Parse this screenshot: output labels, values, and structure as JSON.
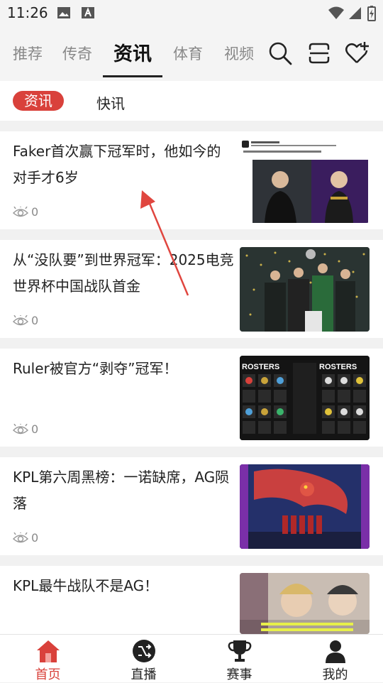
{
  "status_bar": {
    "time": "11:26"
  },
  "top_tabs": [
    {
      "label": "推荐"
    },
    {
      "label": "传奇"
    },
    {
      "label": "资讯"
    },
    {
      "label": "体育"
    },
    {
      "label": "视频"
    }
  ],
  "sub_tabs": [
    {
      "label": "资讯"
    },
    {
      "label": "快讯"
    }
  ],
  "articles": [
    {
      "title": "Faker首次赢下冠军时，他如今的对手才6岁",
      "views": "0",
      "thumb_caption": ""
    },
    {
      "title": "从“没队要”到世界冠军：2025电竞世界杯中国战队首金",
      "views": "0"
    },
    {
      "title": "Ruler被官方“剥夺”冠军！",
      "views": "0",
      "thumb_text_left": "ROSTERS",
      "thumb_text_right": "ROSTERS"
    },
    {
      "title": "KPL第六周黑榜：一诺缺席，AG陨落",
      "views": "0"
    },
    {
      "title": "KPL最牛战队不是AG！",
      "views": ""
    }
  ],
  "bottom_nav": [
    {
      "label": "首页",
      "icon": "home-icon"
    },
    {
      "label": "直播",
      "icon": "live-icon"
    },
    {
      "label": "赛事",
      "icon": "trophy-icon"
    },
    {
      "label": "我的",
      "icon": "profile-icon"
    }
  ],
  "colors": {
    "accent": "#d9413b",
    "annotation_arrow": "#e0463f"
  }
}
